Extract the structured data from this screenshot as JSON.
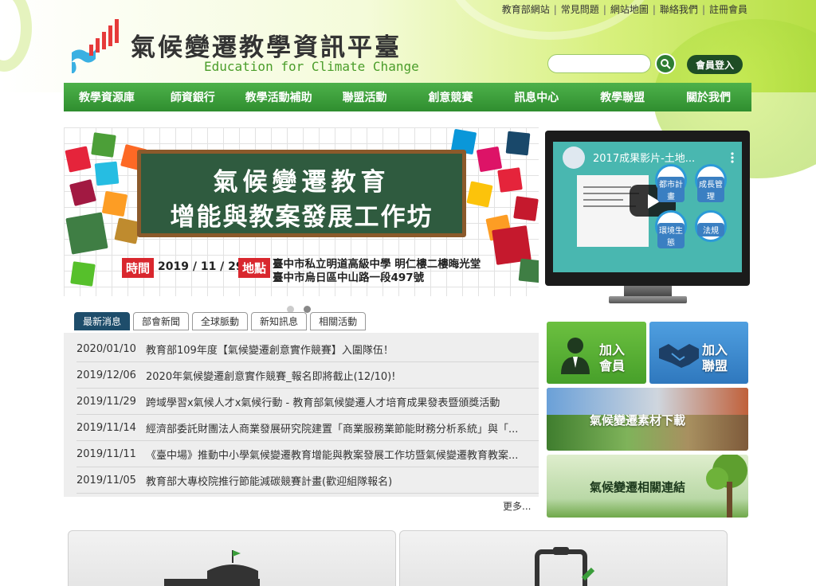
{
  "header": {
    "toplinks": [
      "教育部網站",
      "常見問題",
      "網站地圖",
      "聯絡我們",
      "註冊會員"
    ],
    "site_title": "氣候變遷教學資訊平臺",
    "site_subtitle": "Education for Climate Change",
    "search": {
      "value": "",
      "placeholder": ""
    },
    "login_label": "會員登入"
  },
  "nav": {
    "items": [
      "教學資源庫",
      "師資銀行",
      "教學活動補助",
      "聯盟活動",
      "創意競賽",
      "訊息中心",
      "教學聯盟",
      "關於我們"
    ]
  },
  "banner": {
    "board_line1": "氣候變遷教育",
    "board_line2": "增能與教案發展工作坊",
    "time_label": "時間",
    "time_value": "2019 / 11 / 29",
    "place_label": "地點",
    "place_line1": "臺中市私立明道高級中學 明仁樓二樓晦光堂",
    "place_line2": "臺中市烏日區中山路一段497號",
    "slide_count": 2,
    "active_slide": 2
  },
  "video": {
    "title": "2017成果影片-土地...",
    "bubbles": [
      "都市計畫",
      "成長管理",
      "環境生態",
      "法規"
    ]
  },
  "news": {
    "tabs": [
      "最新消息",
      "部會新聞",
      "全球脈動",
      "新知訊息",
      "相關活動"
    ],
    "active_tab": 0,
    "items": [
      {
        "date": "2020/01/10",
        "title": "教育部109年度【氣候變遷創意實作競賽】入圍隊伍！"
      },
      {
        "date": "2019/12/06",
        "title": "2020年氣候變遷創意實作競賽_報名即將截止(12/10)!"
      },
      {
        "date": "2019/11/29",
        "title": "跨域學習x氣候人才x氣候行動 - 教育部氣候變遷人才培育成果發表暨頒獎活動"
      },
      {
        "date": "2019/11/14",
        "title": "經濟部委託財團法人商業發展研究院建置「商業服務業節能財務分析系統」與「..."
      },
      {
        "date": "2019/11/11",
        "title": "《臺中場》推動中小學氣候變遷教育增能與教案發展工作坊暨氣候變遷教育教案..."
      },
      {
        "date": "2019/11/05",
        "title": "教育部大專校院推行節能減碳競賽計畫(歡迎組隊報名)"
      }
    ],
    "more_label": "更多..."
  },
  "tiles": {
    "join_member": [
      "加入",
      "會員"
    ],
    "join_alliance": [
      "加入",
      "聯盟"
    ],
    "materials": "氣候變遷素材下載",
    "links": "氣候變遷相關連結"
  },
  "colors": {
    "nav_green": "#3a9d3a",
    "tab_active": "#1e4d6b",
    "banner_red": "#d9272e",
    "tile_green": "#5aa831",
    "tile_blue": "#3b84c4"
  }
}
